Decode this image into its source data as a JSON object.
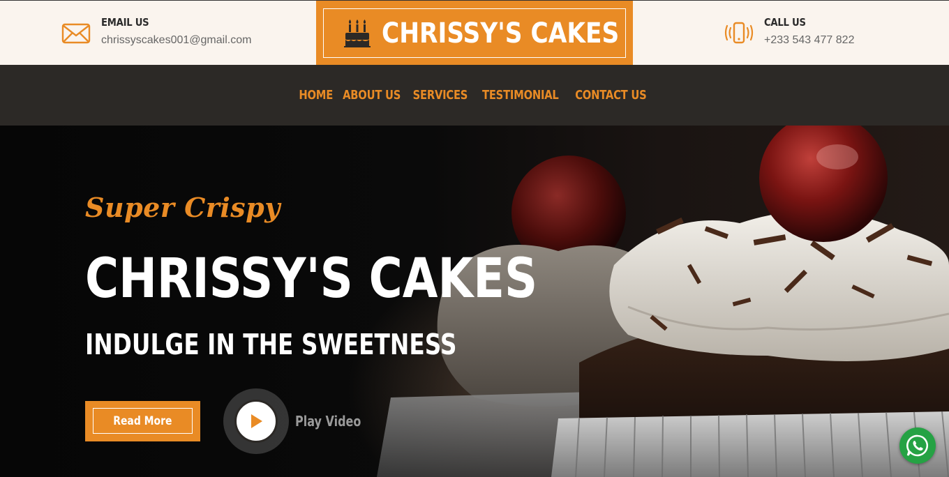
{
  "header": {
    "email": {
      "label": "EMAIL US",
      "value": "chrissyscakes001@gmail.com"
    },
    "logo": {
      "text": "CHRISSY'S CAKES",
      "icon": "birthday-cake-icon"
    },
    "phone": {
      "label": "CALL US",
      "value": "+233 543 477 822"
    }
  },
  "nav": {
    "items": [
      {
        "label": "HOME"
      },
      {
        "label": "ABOUT US"
      },
      {
        "label": "SERVICES"
      },
      {
        "label": "TESTIMONIAL"
      },
      {
        "label": "CONTACT US"
      }
    ]
  },
  "hero": {
    "tagline": "Super Crispy",
    "title": "CHRISSY'S CAKES",
    "subtitle": "INDULGE IN THE SWEETNESS",
    "read_more": "Read More",
    "play_video": "Play Video"
  },
  "floating": {
    "whatsapp_icon": "whatsapp-icon"
  },
  "colors": {
    "accent": "#e98b25",
    "nav_bg": "#2c2926",
    "topbar_bg": "#faf4ee",
    "whatsapp": "#25a244"
  }
}
